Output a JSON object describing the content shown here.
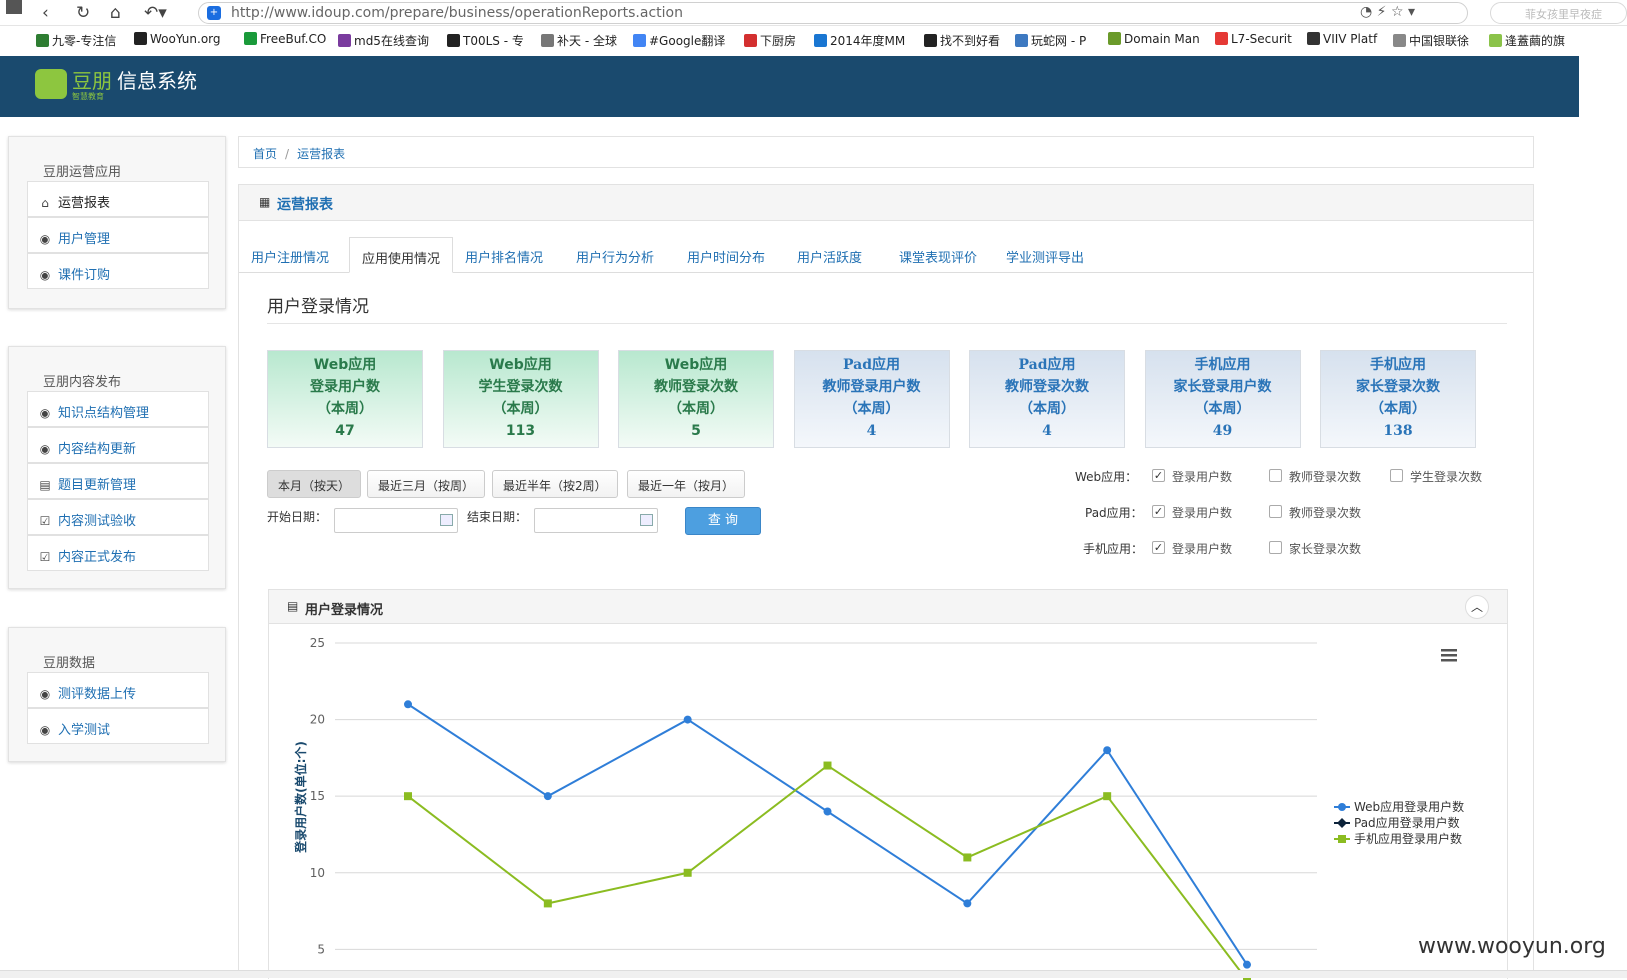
{
  "browser": {
    "url": "http://www.idoup.com/prepare/business/operationReports.action",
    "search_placeholder": "菲女孩里早夜症",
    "bookmarks": [
      "九零-专注信",
      "WooYun.org",
      "FreeBuf.CO",
      "md5在线查询",
      "T00LS - 专",
      "补天 - 全球",
      "#Google翻译",
      "下厨房",
      "2014年度MM",
      "找不到好看",
      "玩蛇网 - P",
      "Domain Man",
      "L7-Securit",
      "VIIV Platf",
      "中国银联徐",
      "逢蓋繭的旗"
    ]
  },
  "header": {
    "brand": "豆朋",
    "brand_sub": "智慧教育",
    "title": "信息系统"
  },
  "sidebar": {
    "groups": [
      {
        "title": "豆朋运营应用",
        "items": [
          {
            "label": "运营报表",
            "icon": "home-icon"
          },
          {
            "label": "用户管理",
            "icon": "eye-icon"
          },
          {
            "label": "课件订购",
            "icon": "eye-icon"
          }
        ]
      },
      {
        "title": "豆朋内容发布",
        "items": [
          {
            "label": "知识点结构管理",
            "icon": "eye-icon"
          },
          {
            "label": "内容结构更新",
            "icon": "eye-icon"
          },
          {
            "label": "题目更新管理",
            "icon": "list-icon"
          },
          {
            "label": "内容测试验收",
            "icon": "check-icon"
          },
          {
            "label": "内容正式发布",
            "icon": "check-icon"
          }
        ]
      },
      {
        "title": "豆朋数据",
        "items": [
          {
            "label": "测评数据上传",
            "icon": "eye-icon"
          },
          {
            "label": "入学测试",
            "icon": "eye-icon"
          }
        ]
      }
    ]
  },
  "breadcrumb": {
    "home": "首页",
    "current": "运营报表"
  },
  "panel": {
    "title": "运营报表",
    "tabs": [
      "用户注册情况",
      "应用使用情况",
      "用户排名情况",
      "用户行为分析",
      "用户时间分布",
      "用户活跃度",
      "课堂表现评价",
      "学业测评导出"
    ],
    "active_tab": "应用使用情况",
    "section_title": "用户登录情况"
  },
  "stats": [
    {
      "l1": "Web应用",
      "l2": "登录用户数",
      "l3": "（本周）",
      "value": "47",
      "tone": "green"
    },
    {
      "l1": "Web应用",
      "l2": "学生登录次数",
      "l3": "（本周）",
      "value": "113",
      "tone": "green"
    },
    {
      "l1": "Web应用",
      "l2": "教师登录次数",
      "l3": "（本周）",
      "value": "5",
      "tone": "green"
    },
    {
      "l1": "Pad应用",
      "l2": "教师登录用户数",
      "l3": "（本周）",
      "value": "4",
      "tone": "blue"
    },
    {
      "l1": "Pad应用",
      "l2": "教师登录次数",
      "l3": "（本周）",
      "value": "4",
      "tone": "blue"
    },
    {
      "l1": "手机应用",
      "l2": "家长登录用户数",
      "l3": "（本周）",
      "value": "49",
      "tone": "blue"
    },
    {
      "l1": "手机应用",
      "l2": "家长登录次数",
      "l3": "（本周）",
      "value": "138",
      "tone": "blue"
    }
  ],
  "ranges": [
    "本月（按天）",
    "最近三月（按周）",
    "最近半年（按2周）",
    "最近一年（按月）"
  ],
  "active_range": "本月（按天）",
  "dates": {
    "start_label": "开始日期：",
    "end_label": "结束日期：",
    "start_value": "",
    "end_value": "",
    "query": "查 询"
  },
  "filters": [
    {
      "label": "Web应用：",
      "items": [
        {
          "name": "登录用户数",
          "checked": true
        },
        {
          "name": "教师登录次数",
          "checked": false
        },
        {
          "name": "学生登录次数",
          "checked": false
        }
      ]
    },
    {
      "label": "Pad应用：",
      "items": [
        {
          "name": "登录用户数",
          "checked": true
        },
        {
          "name": "教师登录次数",
          "checked": false
        }
      ]
    },
    {
      "label": "手机应用：",
      "items": [
        {
          "name": "登录用户数",
          "checked": true
        },
        {
          "name": "家长登录次数",
          "checked": false
        }
      ]
    }
  ],
  "chart_panel_title": "用户登录情况",
  "colors": {
    "web": "#2f7ed8",
    "pad": "#0d233a",
    "mobile": "#8bbc21",
    "nav": "#1a4a6e",
    "link": "#1f6fb2"
  },
  "chart_data": {
    "type": "line",
    "ylabel": "登录用户数(单位:个)",
    "yticks": [
      5,
      10,
      15,
      20,
      25
    ],
    "ylim": [
      3,
      25
    ],
    "x": [
      1,
      2,
      3,
      4,
      5,
      6,
      7
    ],
    "series": [
      {
        "name": "Web应用登录用户数",
        "values": [
          21,
          15,
          20,
          14,
          8,
          18,
          4
        ]
      },
      {
        "name": "Pad应用登录用户数",
        "values": []
      },
      {
        "name": "手机应用登录用户数",
        "values": [
          15,
          8,
          10,
          17,
          11,
          15,
          3
        ]
      }
    ],
    "legend_position": "right",
    "grid": true
  },
  "watermark": "www.wooyun.org"
}
